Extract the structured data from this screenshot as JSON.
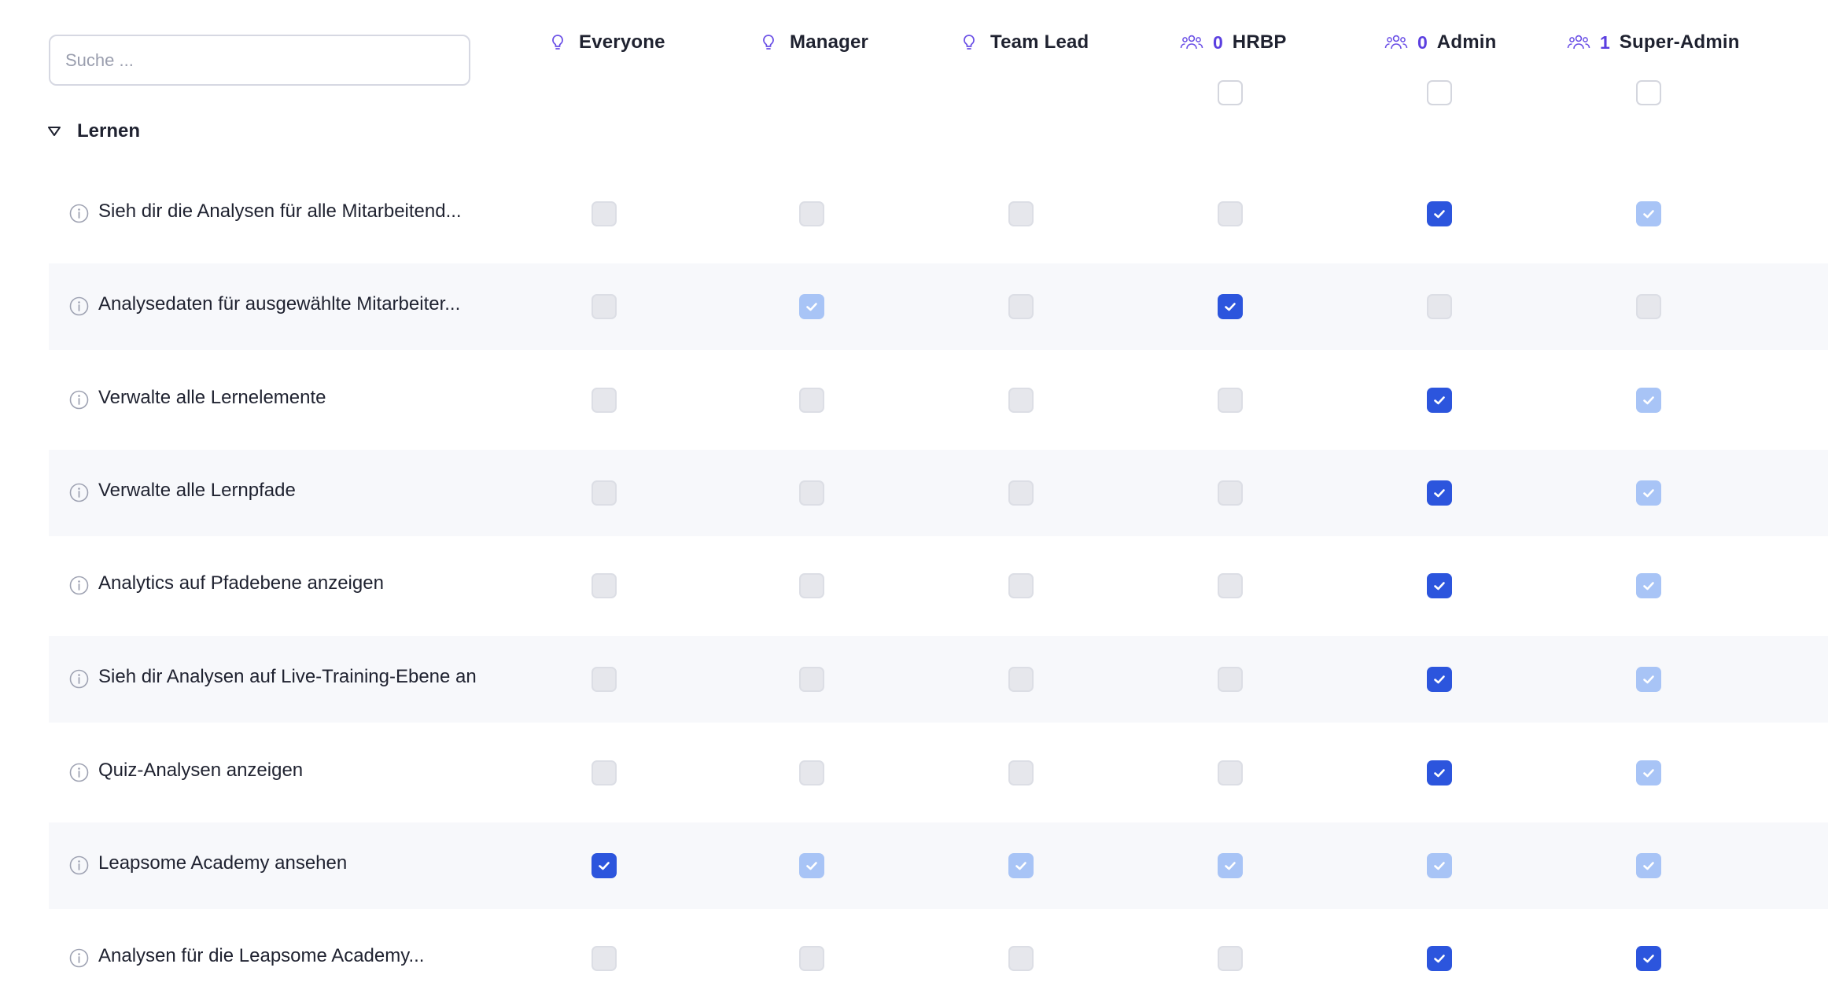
{
  "search": {
    "placeholder": "Suche ..."
  },
  "roles": [
    {
      "label": "Everyone",
      "icon": "lightbulb-icon",
      "count": ""
    },
    {
      "label": "Manager",
      "icon": "lightbulb-icon",
      "count": ""
    },
    {
      "label": "Team Lead",
      "icon": "lightbulb-icon",
      "count": ""
    },
    {
      "label": "HRBP",
      "icon": "users-icon",
      "count": "0"
    },
    {
      "label": "Admin",
      "icon": "users-icon",
      "count": "0"
    },
    {
      "label": "Super-Admin",
      "icon": "users-icon",
      "count": "1"
    }
  ],
  "column_select_all": [
    null,
    null,
    null,
    "unchecked",
    "unchecked",
    "unchecked"
  ],
  "section": {
    "label": "Lernen",
    "expanded": true
  },
  "permissions": [
    {
      "label": "Sieh dir die Analysen für alle Mitarbeitend...",
      "states": [
        "off",
        "off",
        "off",
        "off",
        "on",
        "inherited"
      ]
    },
    {
      "label": "Analysedaten für ausgewählte Mitarbeiter...",
      "states": [
        "off",
        "inherited",
        "off",
        "on",
        "off",
        "off"
      ]
    },
    {
      "label": "Verwalte alle Lernelemente",
      "states": [
        "off",
        "off",
        "off",
        "off",
        "on",
        "inherited"
      ]
    },
    {
      "label": "Verwalte alle Lernpfade",
      "states": [
        "off",
        "off",
        "off",
        "off",
        "on",
        "inherited"
      ]
    },
    {
      "label": "Analytics auf Pfadebene anzeigen",
      "states": [
        "off",
        "off",
        "off",
        "off",
        "on",
        "inherited"
      ]
    },
    {
      "label": "Sieh dir Analysen auf Live-Training-Ebene an",
      "states": [
        "off",
        "off",
        "off",
        "off",
        "on",
        "inherited"
      ]
    },
    {
      "label": "Quiz-Analysen anzeigen",
      "states": [
        "off",
        "off",
        "off",
        "off",
        "on",
        "inherited"
      ]
    },
    {
      "label": "Leapsome Academy ansehen",
      "states": [
        "on",
        "inherited",
        "inherited",
        "inherited",
        "inherited",
        "inherited"
      ]
    },
    {
      "label": "Analysen für die Leapsome Academy...",
      "states": [
        "off",
        "off",
        "off",
        "off",
        "on",
        "on"
      ]
    }
  ],
  "colors": {
    "accent": "#2c55dd",
    "inherited": "#a8c4f6",
    "count": "#5b3fe0",
    "row_alt": "#f7f8fb"
  }
}
